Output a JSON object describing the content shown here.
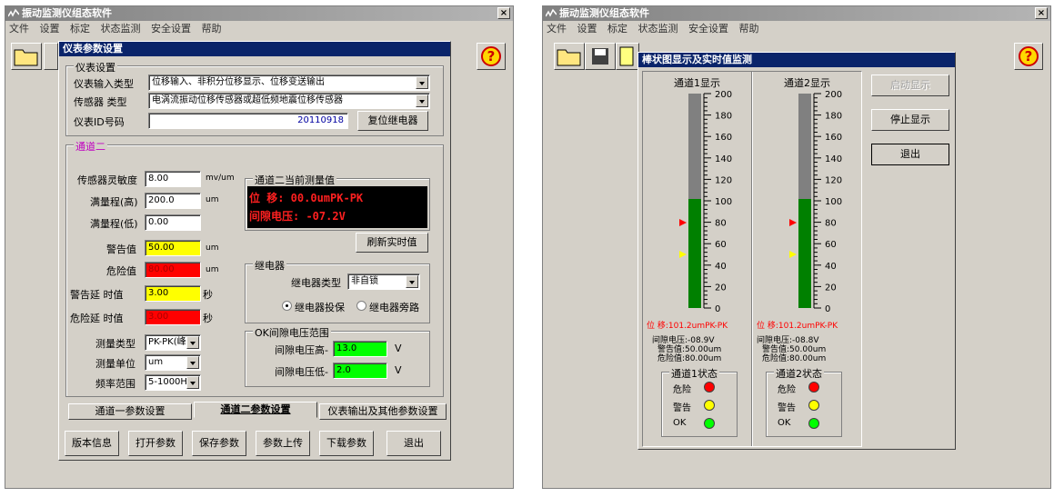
{
  "app_title": "振动监测仪组态软件",
  "menu": [
    "文件",
    "设置",
    "标定",
    "状态监测",
    "安全设置",
    "帮助"
  ],
  "close_glyph": "×",
  "help_glyph": "?",
  "left": {
    "dialog_title": "仪表参数设置",
    "instrument_group": "仪表设置",
    "input_type_label": "仪表输入类型",
    "input_type_value": "位移输入、非积分位移显示、位移变送输出",
    "sensor_type_label": "传感器 类型",
    "sensor_type_value": "电涡流振动位移传感器或超低频地震位移传感器",
    "id_label": "仪表ID号码",
    "id_value": "20110918",
    "reset_relay": "复位继电器",
    "channel_group": "通道二",
    "sensitivity_label": "传感器灵敏度",
    "sensitivity_value": "8.00",
    "sensitivity_unit": "mv/um",
    "range_high_label": "满量程(高)",
    "range_high_value": "200.0",
    "range_high_unit": "um",
    "range_low_label": "满量程(低)",
    "range_low_value": "0.00",
    "warn_label": "警告值",
    "warn_value": "50.00",
    "warn_unit": "um",
    "danger_label": "危险值",
    "danger_value": "80.00",
    "danger_unit": "um",
    "warn_delay_label": "警告延 时值",
    "warn_delay_value": "3.00",
    "warn_delay_unit": "秒",
    "danger_delay_label": "危险延 时值",
    "danger_delay_value": "3.00",
    "danger_delay_unit": "秒",
    "measure_type_label": "测量类型",
    "measure_type_value": "PK-PK(峰",
    "measure_unit_label": "测量单位",
    "measure_unit_value": "um",
    "freq_label": "频率范围",
    "freq_value": "5-1000Hz",
    "current_group": "通道二当前测量值",
    "display_line1": "位  移: 00.0umPK-PK",
    "display_line2": "间隙电压: -07.2V",
    "refresh_button": "刷新实时值",
    "relay_group": "继电器",
    "relay_type_label": "继电器类型",
    "relay_type_value": "非自锁",
    "relay_radio1": "继电器投保",
    "relay_radio2": "继电器旁路",
    "ok_group": "OK间隙电压范围",
    "gap_high_label": "间隙电压高-",
    "gap_high_value": "13.0",
    "gap_high_unit": "V",
    "gap_low_label": "间隙电压低-",
    "gap_low_value": "2.0",
    "gap_low_unit": "V",
    "tabs": [
      "通道一参数设置",
      "通道二参数设置",
      "仪表输出及其他参数设置"
    ],
    "buttons": [
      "版本信息",
      "打开参数",
      "保存参数",
      "参数上传",
      "下载参数",
      "退出"
    ]
  },
  "right": {
    "dialog_title": "棒状图显示及实时值监测",
    "start_button": "启动显示",
    "stop_button": "停止显示",
    "exit_button": "退出",
    "ticks": [
      "200",
      "180",
      "160",
      "140",
      "120",
      "100",
      "80",
      "60",
      "40",
      "20",
      "0"
    ],
    "channels": [
      {
        "title": "通道1显示",
        "fill": 0.51,
        "danger_level": 0.4,
        "warn_level": 0.25,
        "disp": "位  移:101.2umPK-PK",
        "gap": "间隙电压:-08.9V",
        "warn": "警告值:50.00um",
        "danger": "危险值:80.00um",
        "status": "通道1状态",
        "s_danger": "危险",
        "s_warn": "警告",
        "s_ok": "OK"
      },
      {
        "title": "通道2显示",
        "fill": 0.51,
        "danger_level": 0.4,
        "warn_level": 0.25,
        "disp": "位  移:101.2umPK-PK",
        "gap": "间隙电压:-08.8V",
        "warn": "警告值:50.00um",
        "danger": "危险值:80.00um",
        "status": "通道2状态",
        "s_danger": "危险",
        "s_warn": "警告",
        "s_ok": "OK"
      }
    ]
  },
  "colors": {
    "yellow": "#ffff00",
    "red": "#ff0000",
    "green": "#00ff00",
    "bar_green": "#008000",
    "bar_gray": "#808080"
  }
}
